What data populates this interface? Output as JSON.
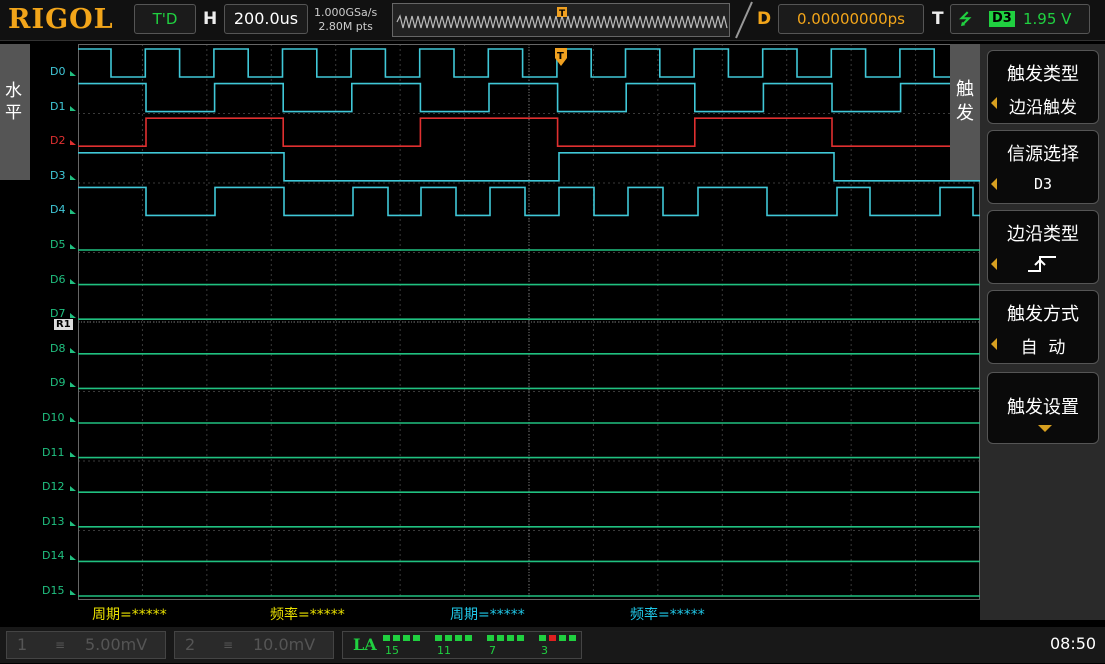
{
  "brand": "RIGOL",
  "header": {
    "mode": "T'D",
    "h_label": "H",
    "timebase": "200.0us",
    "sample_rate": "1.000GSa/s",
    "memory_depth": "2.80M pts",
    "d_label": "D",
    "delay": "0.00000000ps",
    "t_label": "T",
    "trigger_source": "D3",
    "trigger_level": "1.95 V"
  },
  "left_tab": "水平",
  "right_tab": "触发",
  "menu": {
    "trigger_type_title": "触发类型",
    "trigger_type_value": "边沿触发",
    "source_title": "信源选择",
    "source_value": "D3",
    "slope_title": "边沿类型",
    "sweep_title": "触发方式",
    "sweep_value": "自  动",
    "settings_title": "触发设置"
  },
  "channels": [
    "D0",
    "D1",
    "D2",
    "D3",
    "D4",
    "D5",
    "D6",
    "D7",
    "D8",
    "D9",
    "D10",
    "D11",
    "D12",
    "D13",
    "D14",
    "D15"
  ],
  "ref_marker": "R1",
  "measurements": [
    {
      "label": "周期=*****",
      "color": "#e8e000"
    },
    {
      "label": "频率=*****",
      "color": "#e8e000"
    },
    {
      "label": "周期=*****",
      "color": "#20c8e8"
    },
    {
      "label": "频率=*****",
      "color": "#20c8e8"
    }
  ],
  "bottom": {
    "ch1_num": "1",
    "ch1_scale": "5.00mV",
    "ch2_num": "2",
    "ch2_scale": "10.0mV",
    "la_label": "LA",
    "la_groups": [
      "15",
      "11",
      "7",
      "3"
    ],
    "time": "08:50"
  },
  "colors": {
    "accent": "#f2a51a",
    "digital_high": "#40c8d8",
    "digital_low": "#20c080",
    "d2": "#e03030",
    "grid": "#3a3a3a"
  }
}
